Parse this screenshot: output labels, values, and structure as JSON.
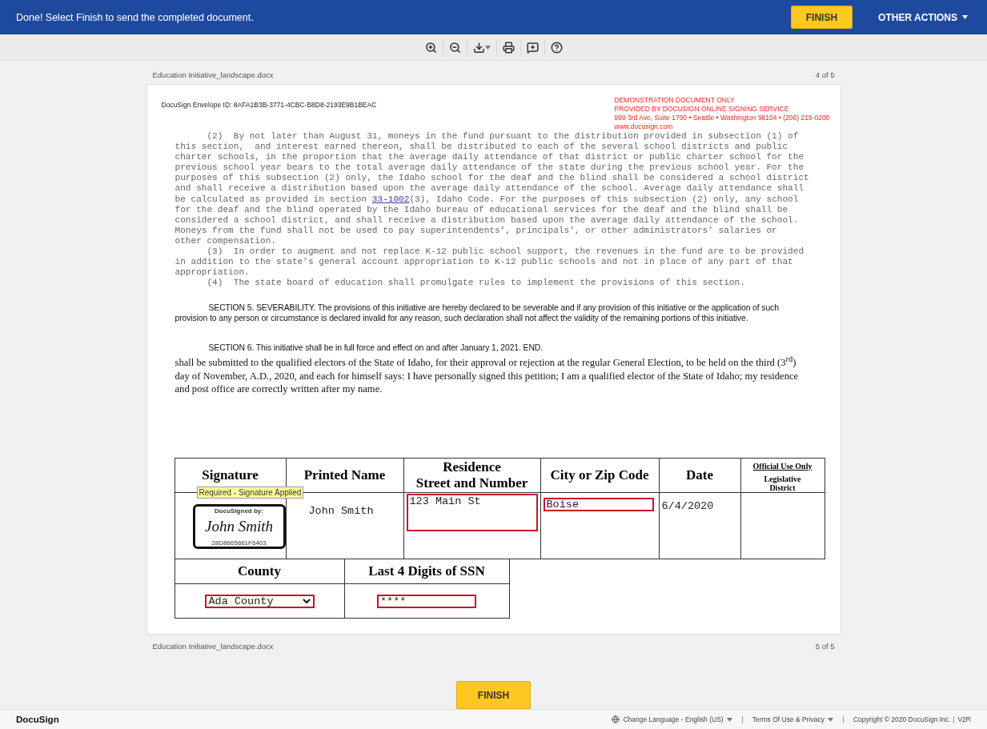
{
  "top_bar": {
    "message": "Done! Select Finish to send the completed document.",
    "finish_button": "FINISH",
    "other_actions": "OTHER ACTIONS"
  },
  "document": {
    "file_name_top": "Education Initiative_landscape.docx",
    "page_top": "4 of 5",
    "file_name_bottom": "Education Initiative_landscape.docx",
    "page_bottom": "5 of 5",
    "envelope_id": "DocuSign Envelope ID: 8AFA1B3B-3771-4CBC-B8D8-2193E9B1BEAC",
    "stamp": [
      "DEMONSTRATION DOCUMENT ONLY",
      "PROVIDED BY DOCUSIGN ONLINE SIGNING SERVICE",
      "999 3rd Ave, Suite 1700  • Seattle • Washington 98104 • (206) 219-0200",
      "www.docusign.com"
    ],
    "paragraph_2": {
      "before": "      (2)  By not later than August 31, moneys in the fund pursuant to the distribution provided in subsection (1) of\nthis section,  and interest earned thereon, shall be distributed to each of the several school districts and public\ncharter schools, in the proportion that the average daily attendance of that district or public charter school for the\nprevious school year bears to the total average daily attendance of the state during the previous school year. For the\npurposes of this subsection (2) only, the Idaho school for the deaf and the blind shall be considered a school district\nand shall receive a distribution based upon the average daily attendance of the school. Average daily attendance shall\nbe calculated as provided in section ",
      "link": "33-1002",
      "after": "(3), Idaho Code. For the purposes of this subsection (2) only, any school\nfor the deaf and the blind operated by the Idaho bureau of educational services for the deaf and the blind shall be\nconsidered a school district, and shall receive a distribution based upon the average daily attendance of the school.\nMoneys from the fund shall not be used to pay superintendents’, principals’, or other administrators’ salaries or\nother compensation."
    },
    "paragraph_3": "      (3)  In order to augment and not replace K-12 public school support, the revenues in the fund are to be provided\nin addition to the state’s general account appropriation to K-12 public schools and not in place of any part of that\nappropriation.",
    "paragraph_4": "      (4)  The state board of education shall promulgate rules to implement the provisions of this section.",
    "section_5": "SECTION 5. SEVERABILITY. The provisions of this initiative are hereby declared to be severable and if any provision of this initiative or the application of such provision to any person or circumstance is declared invalid for any reason, such declaration shall not affect the validity of the remaining portions of this initiative.",
    "section_6": "SECTION 6. This initiative shall be in full force and effect on and after January 1, 2021. END.",
    "oath": "shall be submitted to the qualified electors of the State of Idaho, for their approval or rejection at the regular General Election, to be held on the third (3$^{rd}$) day of November, A.D., 2020, and each for himself says:  I have personally signed this petition; I am a qualified elector of the State of Idaho; my residence and post office are correctly written after my name.",
    "table": {
      "columns": [
        "Signature",
        "Printed Name",
        "Residence\nStreet and Number",
        "City or Zip Code",
        "Date"
      ],
      "official_use": {
        "title": "Official Use Only",
        "lines": "Legislative\nDistrict"
      },
      "tooltip": "Required - Signature Applied",
      "signature": {
        "caption": "DocuSigned by:",
        "name": "John Smith",
        "code": "28D8665861F6403"
      },
      "printed_name": "John Smith",
      "street": "123 Main St",
      "city": "Boise",
      "date": "6/4/2020"
    },
    "table_2": {
      "columns": [
        "County",
        "Last 4 Digits of SSN"
      ],
      "county": "Ada County",
      "ssn": "****"
    },
    "finish_button": "FINISH"
  },
  "footer": {
    "brand": "DocuSign",
    "language": "Change Language - English (US)",
    "terms": "Terms Of Use & Privacy",
    "copyright": "Copyright © 2020 DocuSign Inc.",
    "version": "V2R"
  }
}
